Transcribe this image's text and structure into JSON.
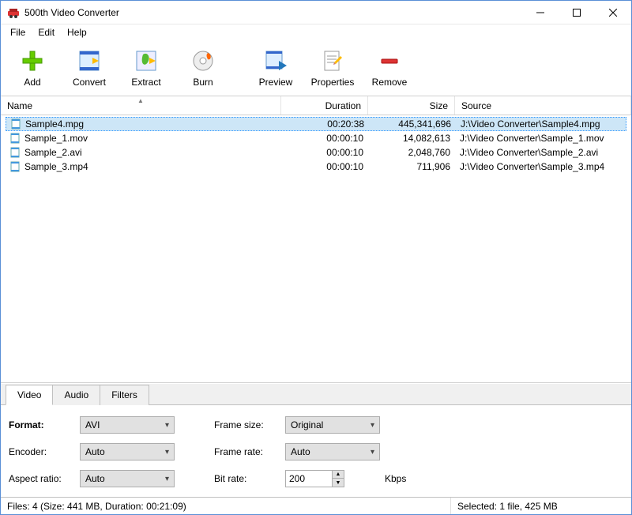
{
  "window": {
    "title": "500th Video Converter"
  },
  "menu": {
    "file": "File",
    "edit": "Edit",
    "help": "Help"
  },
  "toolbar": {
    "add": "Add",
    "convert": "Convert",
    "extract": "Extract",
    "burn": "Burn",
    "preview": "Preview",
    "properties": "Properties",
    "remove": "Remove"
  },
  "columns": {
    "name": "Name",
    "duration": "Duration",
    "size": "Size",
    "source": "Source"
  },
  "files": [
    {
      "name": "Sample4.mpg",
      "duration": "00:20:38",
      "size": "445,341,696",
      "source": "J:\\Video Converter\\Sample4.mpg",
      "selected": true
    },
    {
      "name": "Sample_1.mov",
      "duration": "00:00:10",
      "size": "14,082,613",
      "source": "J:\\Video Converter\\Sample_1.mov",
      "selected": false
    },
    {
      "name": "Sample_2.avi",
      "duration": "00:00:10",
      "size": "2,048,760",
      "source": "J:\\Video Converter\\Sample_2.avi",
      "selected": false
    },
    {
      "name": "Sample_3.mp4",
      "duration": "00:00:10",
      "size": "711,906",
      "source": "J:\\Video Converter\\Sample_3.mp4",
      "selected": false
    }
  ],
  "tabs": {
    "video": "Video",
    "audio": "Audio",
    "filters": "Filters"
  },
  "video_settings": {
    "format_label": "Format:",
    "format_value": "AVI",
    "encoder_label": "Encoder:",
    "encoder_value": "Auto",
    "aspect_label": "Aspect ratio:",
    "aspect_value": "Auto",
    "framesize_label": "Frame size:",
    "framesize_value": "Original",
    "framerate_label": "Frame rate:",
    "framerate_value": "Auto",
    "bitrate_label": "Bit rate:",
    "bitrate_value": "200",
    "bitrate_unit": "Kbps"
  },
  "status": {
    "left": "Files: 4 (Size: 441 MB, Duration: 00:21:09)",
    "right": "Selected: 1 file, 425 MB"
  }
}
